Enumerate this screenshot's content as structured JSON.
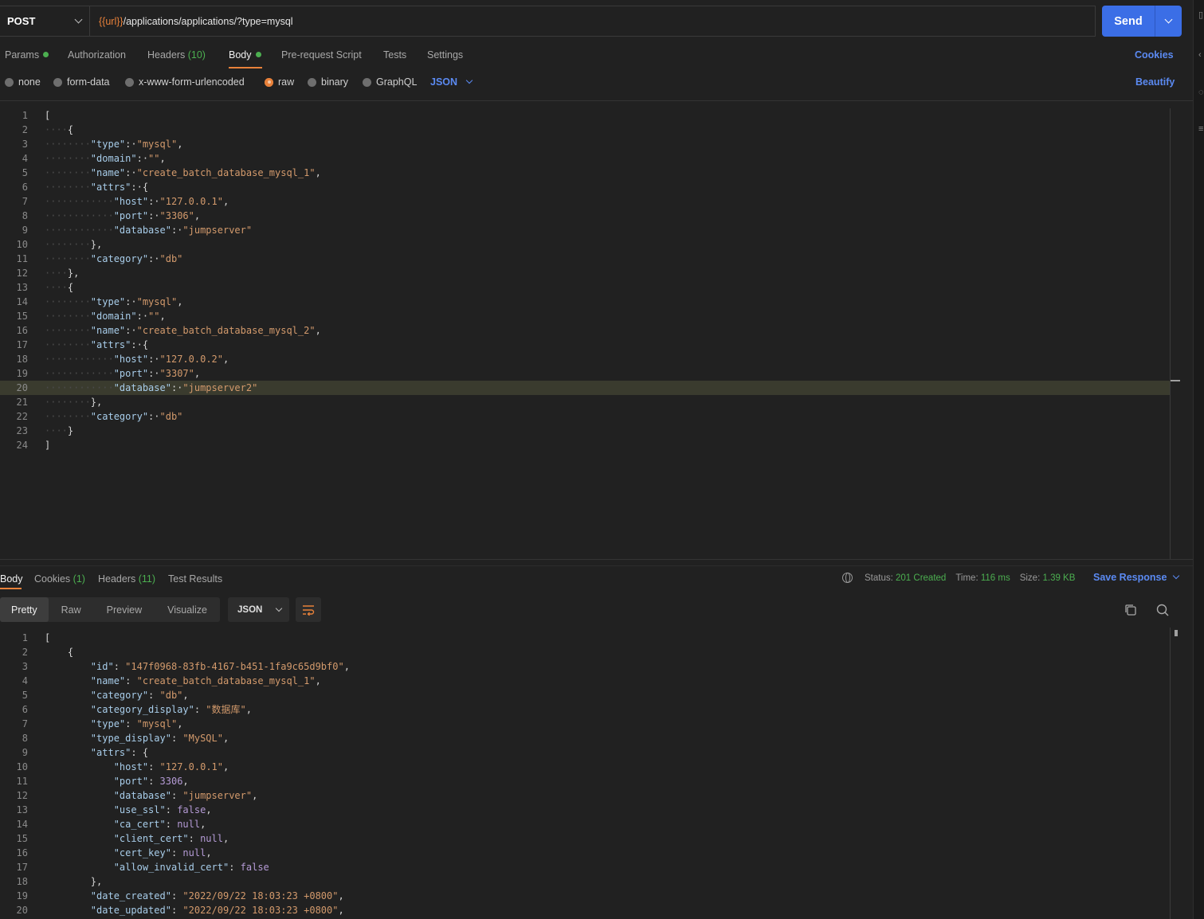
{
  "request": {
    "method": "POST",
    "url_variable": "{{url}}",
    "url_path": "/applications/applications/?type=mysql",
    "send_label": "Send"
  },
  "request_tabs": {
    "params": "Params",
    "authorization": "Authorization",
    "headers": "Headers",
    "headers_count": "(10)",
    "body": "Body",
    "pre_request": "Pre-request Script",
    "tests": "Tests",
    "settings": "Settings",
    "cookies": "Cookies"
  },
  "body_types": {
    "none": "none",
    "form_data": "form-data",
    "urlencoded": "x-www-form-urlencoded",
    "raw": "raw",
    "binary": "binary",
    "graphql": "GraphQL",
    "language": "JSON",
    "beautify": "Beautify"
  },
  "request_body_lines": [
    "[",
    "····{",
    "········\"type\":·\"mysql\",",
    "········\"domain\":·\"\",",
    "········\"name\":·\"create_batch_database_mysql_1\",",
    "········\"attrs\":·{",
    "············\"host\":·\"127.0.0.1\",",
    "············\"port\":·\"3306\",",
    "············\"database\":·\"jumpserver\"",
    "········},",
    "········\"category\":·\"db\"",
    "····},",
    "····{",
    "········\"type\":·\"mysql\",",
    "········\"domain\":·\"\",",
    "········\"name\":·\"create_batch_database_mysql_2\",",
    "········\"attrs\":·{",
    "············\"host\":·\"127.0.0.2\",",
    "············\"port\":·\"3307\",",
    "············\"database\":·\"jumpserver2\"",
    "········},",
    "········\"category\":·\"db\"",
    "····}",
    "]"
  ],
  "response_tabs": {
    "body": "Body",
    "cookies": "Cookies",
    "cookies_count": "(1)",
    "headers": "Headers",
    "headers_count": "(11)",
    "test_results": "Test Results"
  },
  "response_status": {
    "status_label": "Status:",
    "status_value": "201 Created",
    "time_label": "Time:",
    "time_value": "116 ms",
    "size_label": "Size:",
    "size_value": "1.39 KB",
    "save_response": "Save Response"
  },
  "response_view": {
    "pretty": "Pretty",
    "raw": "Raw",
    "preview": "Preview",
    "visualize": "Visualize",
    "format": "JSON"
  },
  "response_body_lines": [
    "[",
    "    {",
    "        \"id\": \"147f0968-83fb-4167-b451-1fa9c65d9bf0\",",
    "        \"name\": \"create_batch_database_mysql_1\",",
    "        \"category\": \"db\",",
    "        \"category_display\": \"数据库\",",
    "        \"type\": \"mysql\",",
    "        \"type_display\": \"MySQL\",",
    "        \"attrs\": {",
    "            \"host\": \"127.0.0.1\",",
    "            \"port\": 3306,",
    "            \"database\": \"jumpserver\",",
    "            \"use_ssl\": false,",
    "            \"ca_cert\": null,",
    "            \"client_cert\": null,",
    "            \"cert_key\": null,",
    "            \"allow_invalid_cert\": false",
    "        },",
    "        \"date_created\": \"2022/09/22 18:03:23 +0800\",",
    "        \"date_updated\": \"2022/09/22 18:03:23 +0800\","
  ],
  "colors": {
    "accent": "#e8813a",
    "primary": "#3b6ee6",
    "link": "#5b8af2",
    "success": "#4caf50"
  }
}
